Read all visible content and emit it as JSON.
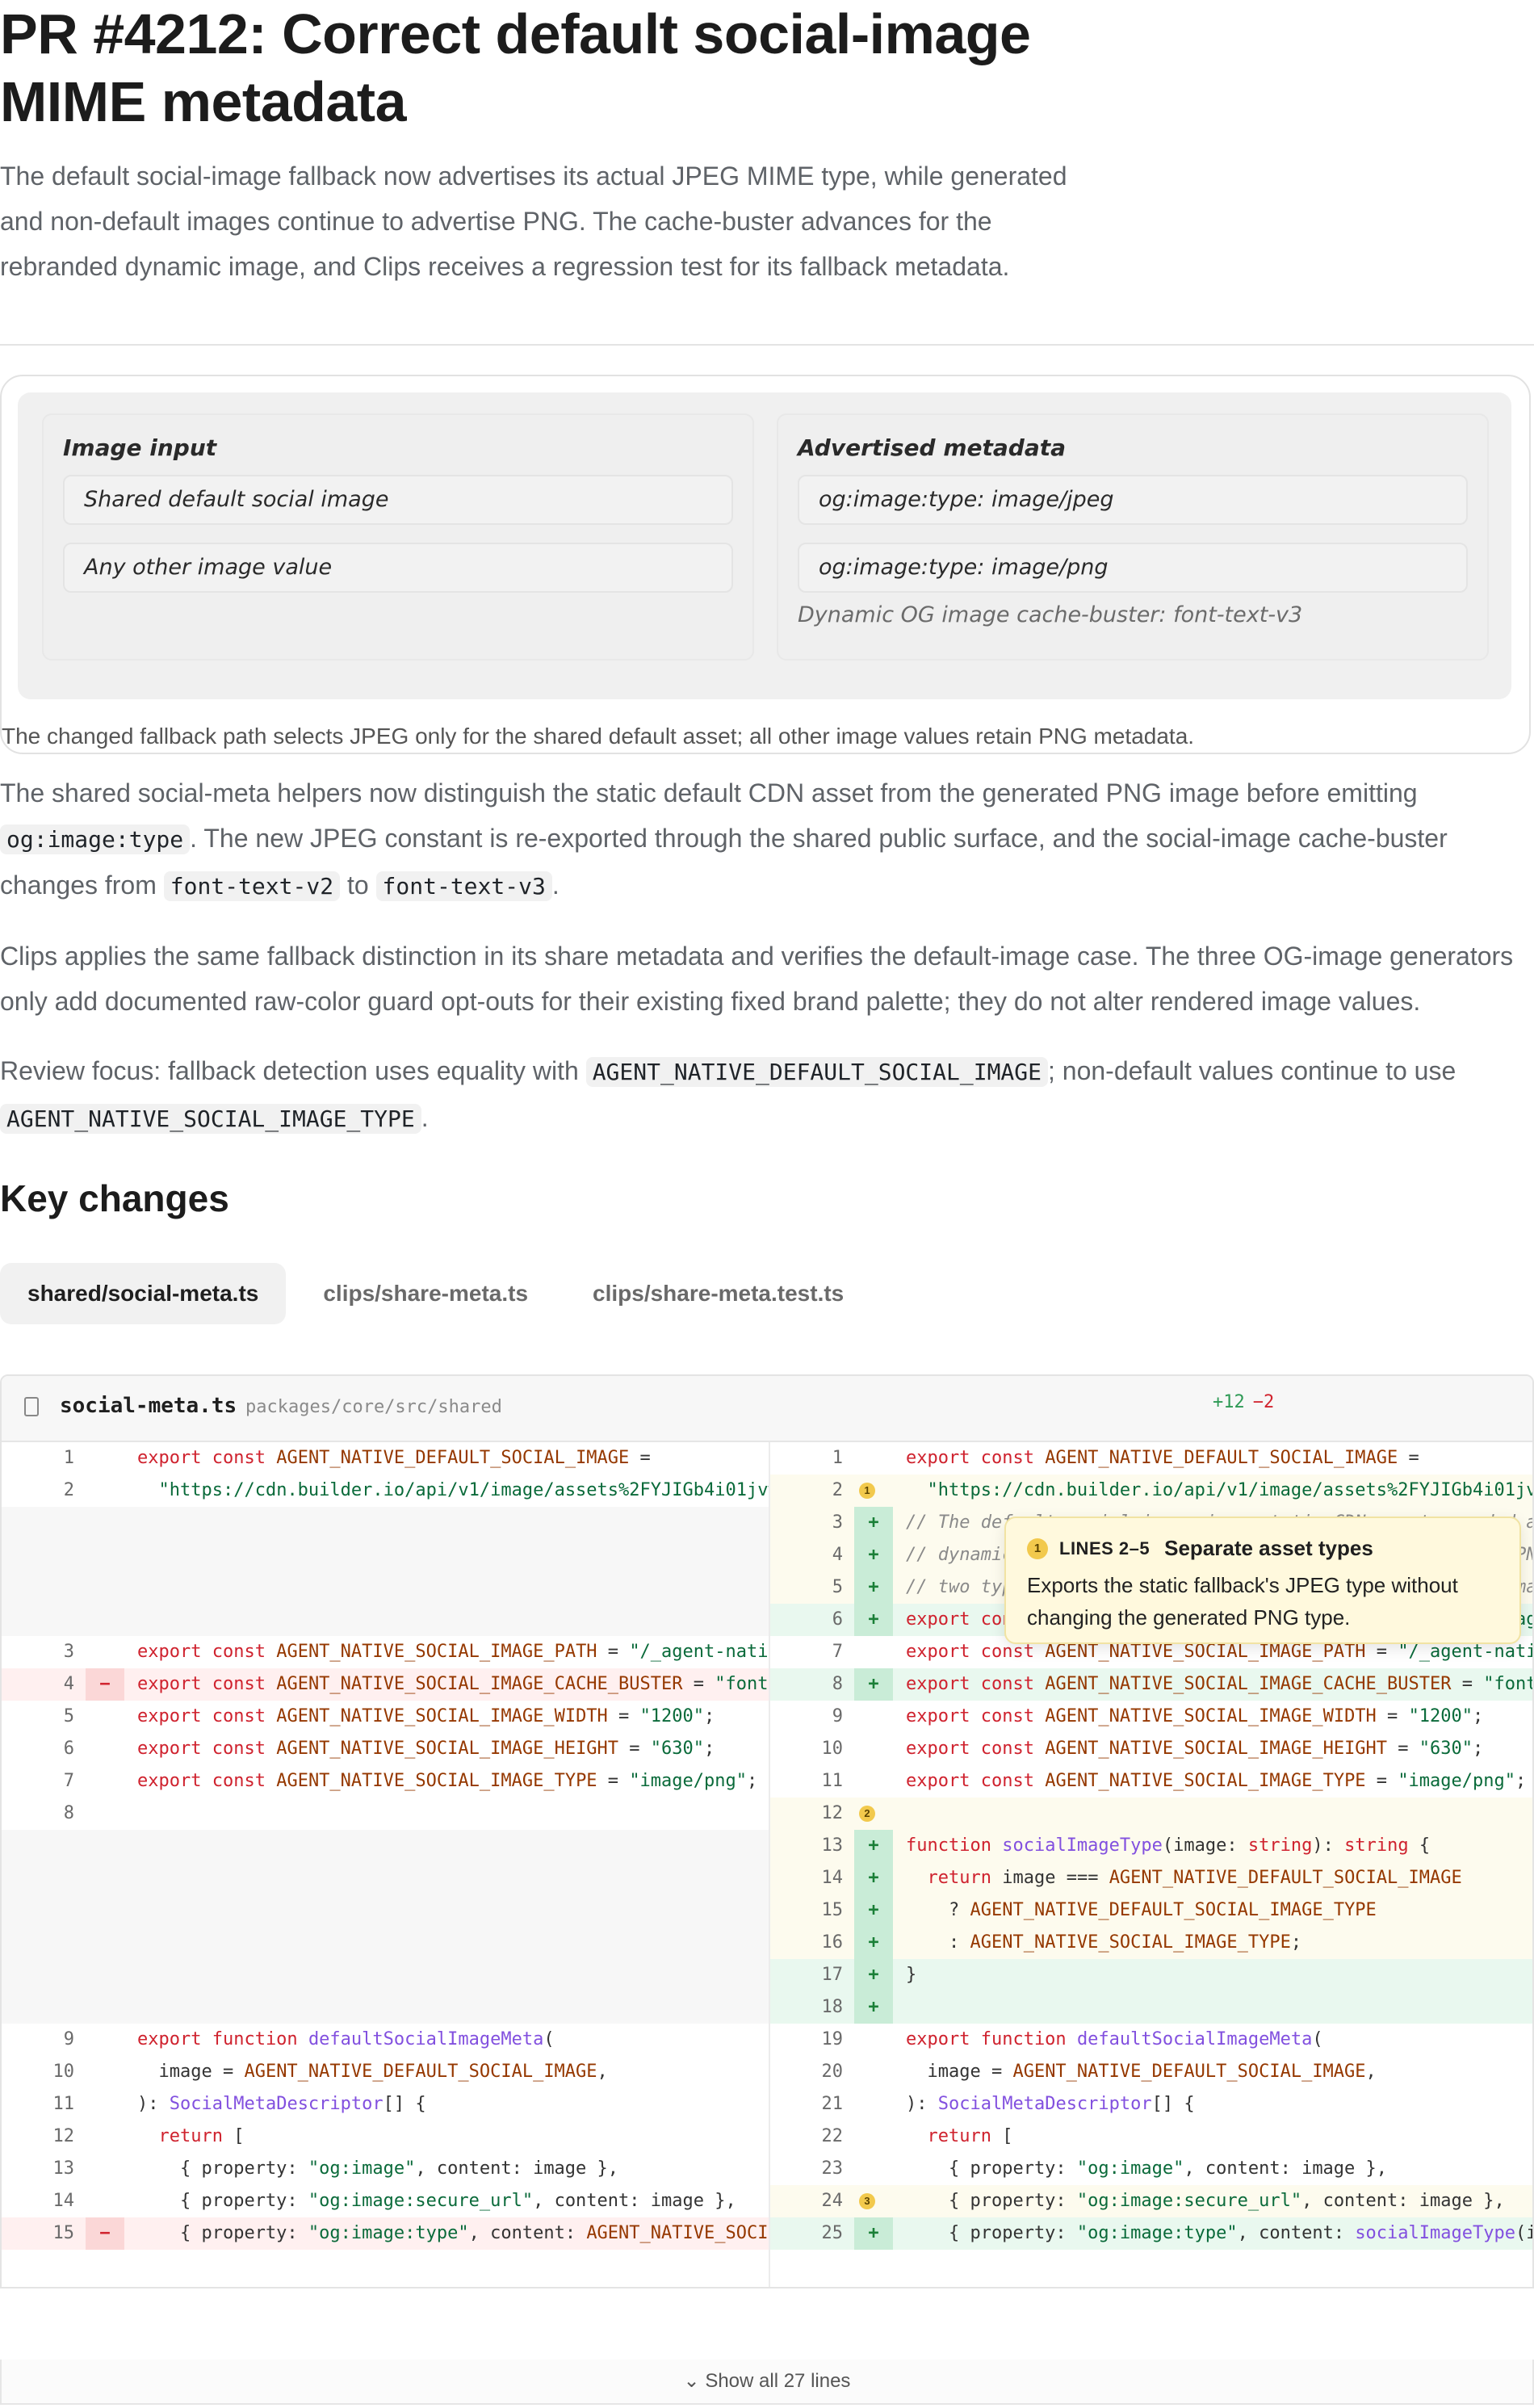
{
  "pr": {
    "title": "PR #4212: Correct default social-image MIME metadata",
    "summary": "The default social-image fallback now advertises its actual JPEG MIME type, while generated and non-default images continue to advertise PNG. The cache-buster advances for the rebranded dynamic image, and Clips receives a regression test for its fallback metadata."
  },
  "diagram": {
    "left_title": "Image input",
    "left_rows": [
      "Shared default social image",
      "Any other image value"
    ],
    "right_title": "Advertised metadata",
    "right_rows": [
      "og:image:type: image/jpeg",
      "og:image:type: image/png"
    ],
    "right_note": "Dynamic OG image cache-buster: font-text-v3",
    "caption": "The changed fallback path selects JPEG only for the shared default asset; all other image values retain PNG metadata."
  },
  "prose": {
    "p1_a": "The shared social-meta helpers now distinguish the static default CDN asset from the generated PNG image before emitting ",
    "p1_code1": "og:image:type",
    "p1_b": ". The new JPEG constant is re-exported through the shared public surface, and the social-image cache-buster changes from ",
    "p1_code2": "font-text-v2",
    "p1_c": " to ",
    "p1_code3": "font-text-v3",
    "p1_d": ".",
    "p2": "Clips applies the same fallback distinction in its share metadata and verifies the default-image case. The three OG-image generators only add documented raw-color guard opt-outs for their existing fixed brand palette; they do not alter rendered image values.",
    "p3_a": "Review focus: fallback detection uses equality with ",
    "p3_code1": "AGENT_NATIVE_DEFAULT_SOCIAL_IMAGE",
    "p3_b": "; non-default values continue to use ",
    "p3_code2": "AGENT_NATIVE_SOCIAL_IMAGE_TYPE",
    "p3_c": "."
  },
  "key_changes_heading": "Key changes",
  "tabs": [
    "shared/social-meta.ts",
    "clips/share-meta.ts",
    "clips/share-meta.test.ts"
  ],
  "diff": {
    "file_name": "social-meta.ts",
    "file_path": "packages/core/src/shared",
    "added": "+12",
    "removed": "−2",
    "show_all": "Show all 27 lines"
  },
  "popover": {
    "badge": "1",
    "lines": "LINES 2–5",
    "title": "Separate asset types",
    "body": "Exports the static fallback's JPEG type without changing the generated PNG type."
  },
  "colors": {
    "added_bg": "#e9f8ef",
    "removed_bg": "#fff0f0",
    "annotation": "#f2c94c"
  }
}
